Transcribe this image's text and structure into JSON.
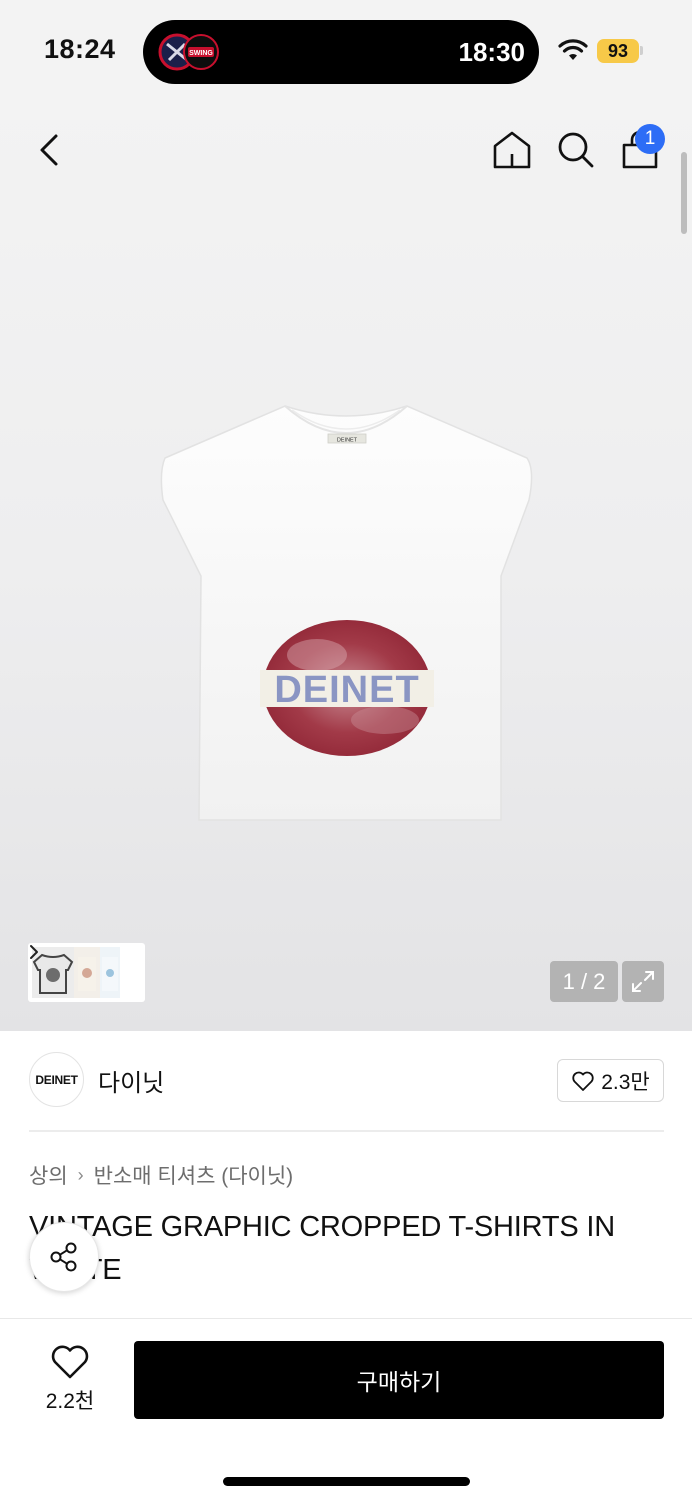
{
  "status_bar": {
    "time": "18:24",
    "island_time": "18:30",
    "battery": "93",
    "island_badge_text": "SWING"
  },
  "nav": {
    "cart_count": "1"
  },
  "product_image": {
    "print_text": "DEINET",
    "label_text": "DEINET",
    "page_counter": "1 / 2"
  },
  "brand": {
    "logo_text": "DEINET",
    "name": "다이닛",
    "like_count": "2.3만"
  },
  "breadcrumb": {
    "category": "상의",
    "subcategory": "반소매 티셔츠 (다이닛)"
  },
  "product": {
    "title": "VINTAGE GRAPHIC CROPPED T-SHIRTS IN WHITE"
  },
  "bottom_bar": {
    "wish_count": "2.2천",
    "buy_label": "구매하기"
  },
  "colors": {
    "accent_badge": "#2d6df6",
    "battery": "#f7c948",
    "buy_button": "#000000",
    "print_red": "#9b2b3a",
    "print_blue": "#7d87b8"
  }
}
